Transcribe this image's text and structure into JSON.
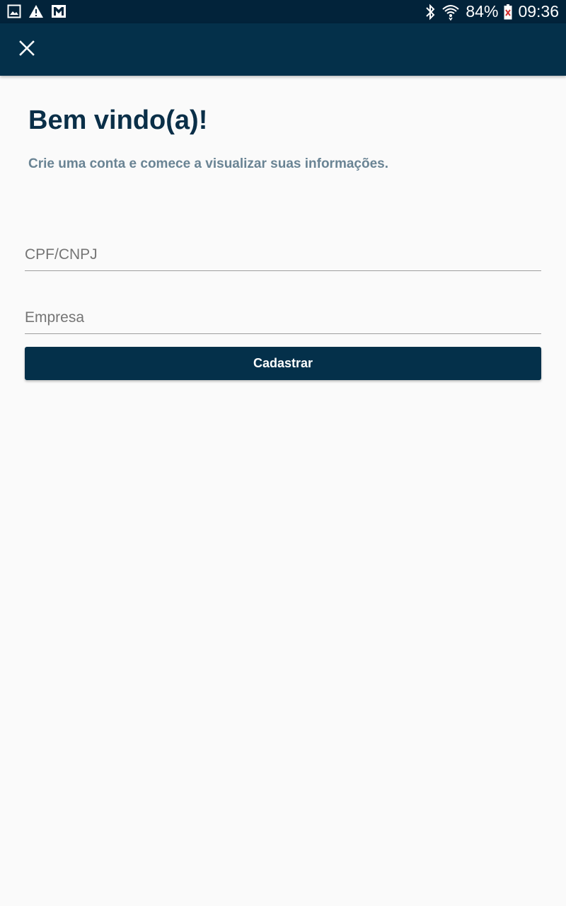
{
  "status_bar": {
    "battery": "84%",
    "time": "09:36",
    "icons": [
      "image-icon",
      "warning-icon",
      "gmail-icon",
      "bluetooth-icon",
      "wifi-icon",
      "battery-icon"
    ]
  },
  "app_bar": {
    "close_icon": "close-icon"
  },
  "content": {
    "title": "Bem vindo(a)!",
    "subtitle": "Crie uma conta e comece a visualizar suas informações.",
    "fields": {
      "cpf_placeholder": "CPF/CNPJ",
      "cpf_value": "",
      "empresa_placeholder": "Empresa",
      "empresa_value": ""
    },
    "submit_label": "Cadastrar"
  },
  "colors": {
    "status_bar": "#02233a",
    "app_bar": "#04304a",
    "title": "#0a2f48",
    "subtitle": "#6a8494",
    "background": "#fafafa"
  }
}
